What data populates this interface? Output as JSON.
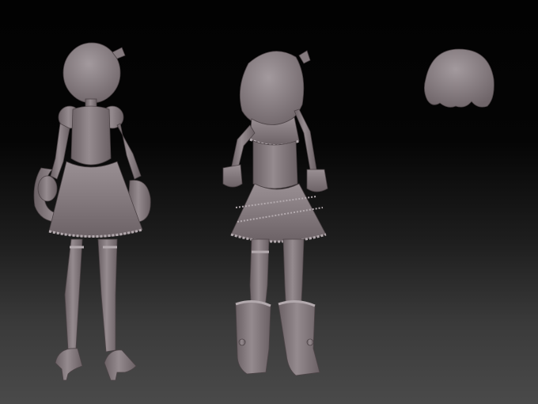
{
  "scene": {
    "background_top": "#030303",
    "background_bottom": "#4a4a4a",
    "model_color": "#8a7f83",
    "model_shadow": "#5a5053",
    "model_highlight": "#a89fa2",
    "objects": [
      {
        "name": "figure-short-hair-doll"
      },
      {
        "name": "figure-long-hair-doll"
      },
      {
        "name": "hair-bob-piece"
      }
    ]
  }
}
